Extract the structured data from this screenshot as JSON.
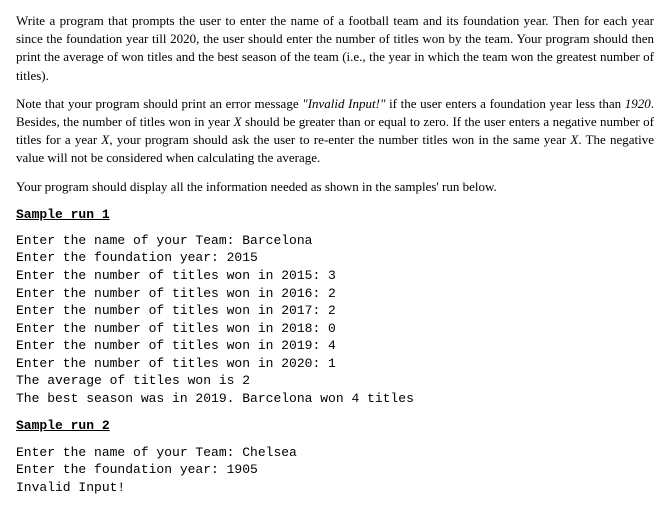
{
  "paragraphs": {
    "p1": "Write a program that prompts the user to enter the name of a football team and its foundation year. Then for each year since the foundation year till 2020, the user should enter the number of titles won by the team. Your program should then print the average of won titles and the best season of the team (i.e., the year in which the team won the greatest number of titles).",
    "p2_prefix": "Note that your program should print an error message ",
    "p2_quoted": "\"Invalid Input!\"",
    "p2_middle1": " if the user enters a foundation year less than ",
    "p2_1920": "1920",
    "p2_middle2": ". Besides, the number of titles won in year ",
    "p2_x1": "X",
    "p2_middle3": " should be greater than or equal to zero. If the user enters a negative number of titles for a year ",
    "p2_x2": "X",
    "p2_middle4": ", your program should ask the user to re-enter the number titles won in the same year ",
    "p2_x3": "X",
    "p2_suffix": ". The negative value will not be considered when calculating the average.",
    "p3": "Your program should display all the information needed as shown in the samples' run below."
  },
  "sample1": {
    "heading": "Sample run 1",
    "lines": "Enter the name of your Team: Barcelona\nEnter the foundation year: 2015\nEnter the number of titles won in 2015: 3\nEnter the number of titles won in 2016: 2\nEnter the number of titles won in 2017: 2\nEnter the number of titles won in 2018: 0\nEnter the number of titles won in 2019: 4\nEnter the number of titles won in 2020: 1\nThe average of titles won is 2\nThe best season was in 2019. Barcelona won 4 titles"
  },
  "sample2": {
    "heading": "Sample run 2",
    "lines": "Enter the name of your Team: Chelsea\nEnter the foundation year: 1905\nInvalid Input!"
  }
}
